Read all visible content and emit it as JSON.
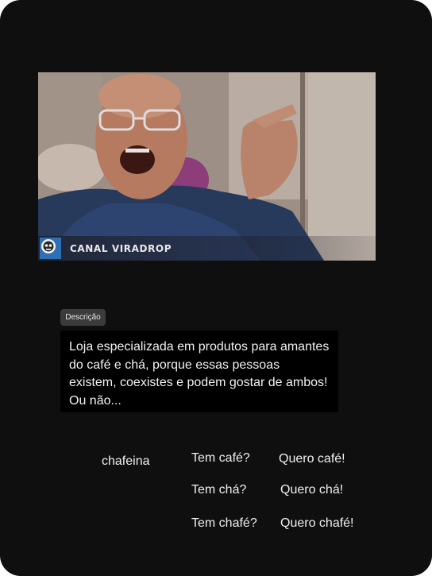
{
  "video": {
    "channel_name": "CANAL VIRADROP"
  },
  "description": {
    "badge": "Descrição",
    "text": "Loja especializada em produtos para amantes do café e chá, porque essas pessoas existem, coexistes e podem gostar de ambos! Ou não..."
  },
  "brand": "chafeina",
  "options": {
    "tem_cafe": "Tem café?",
    "quero_cafe": "Quero café!",
    "tem_cha": "Tem chá?",
    "quero_cha": "Quero chá!",
    "tem_chafe": "Tem chafé?",
    "quero_chafe": "Quero chafé!"
  },
  "colors": {
    "background": "#0f0f0f",
    "description_box": "#000000",
    "badge": "#3b3b3b",
    "text": "#f0f0f0",
    "channel_logo": "#2f6fb5"
  }
}
